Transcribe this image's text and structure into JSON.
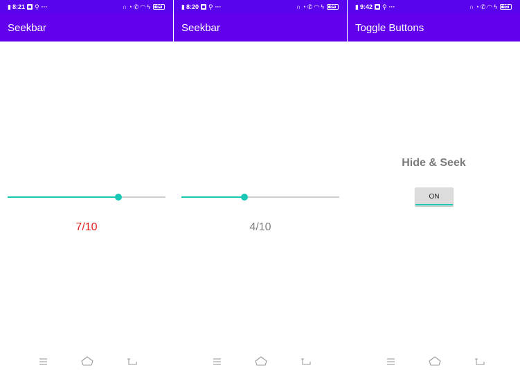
{
  "phones": [
    {
      "status_bar": {
        "time": "8:21",
        "battery": "84"
      },
      "app_bar": {
        "title": "Seekbar"
      },
      "seekbar": {
        "progress": 7,
        "max": 10,
        "value_label": "7/10"
      }
    },
    {
      "status_bar": {
        "time": "8:20",
        "battery": "84"
      },
      "app_bar": {
        "title": "Seekbar"
      },
      "seekbar": {
        "progress": 4,
        "max": 10,
        "value_label": "4/10"
      }
    },
    {
      "status_bar": {
        "time": "9:42",
        "battery": "85"
      },
      "app_bar": {
        "title": "Toggle Buttons"
      },
      "label": "Hide & Seek",
      "toggle": {
        "state_label": "ON",
        "checked": true
      }
    }
  ],
  "colors": {
    "status_bar": "#5a04ee",
    "app_bar": "#6200ee",
    "accent": "#18c8b4",
    "seek_value_red": "#e02020",
    "seek_value_gray": "#808080"
  },
  "icons": {
    "status": [
      "signal-icon",
      "notification-icon",
      "usb-icon",
      "more-icon",
      "headphones-icon",
      "alarm-icon",
      "call-icon",
      "wifi-icon",
      "charging-icon",
      "battery-icon"
    ],
    "nav": [
      "menu-icon",
      "home-icon",
      "back-icon"
    ]
  }
}
